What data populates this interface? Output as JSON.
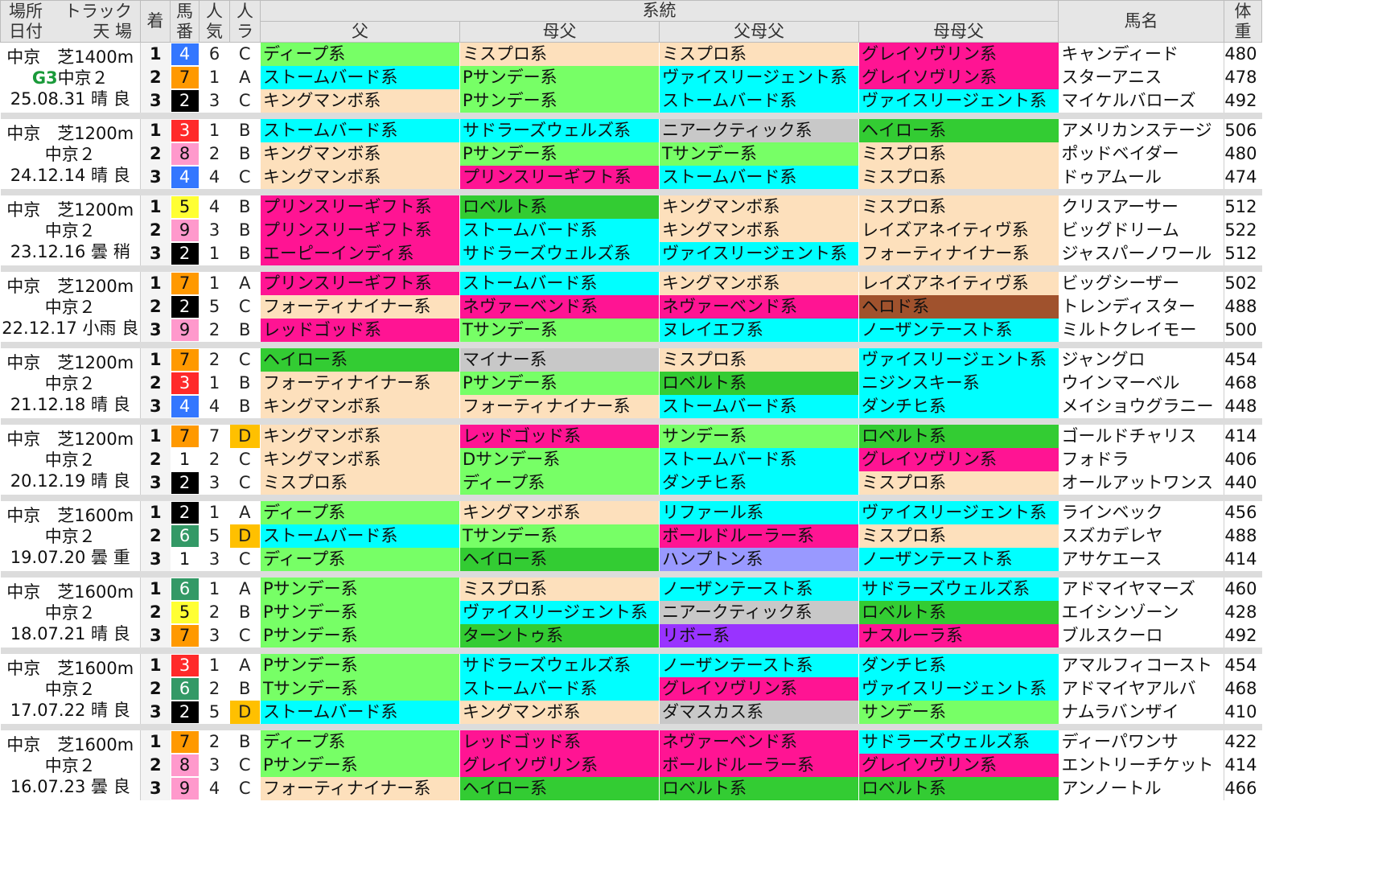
{
  "header": {
    "basho": "場所",
    "track": "トラック",
    "hizuke": "日付",
    "tenba": "天 場",
    "chaku": "着",
    "umaban": "馬番",
    "ninki": "人気",
    "ra": "人ラ",
    "keito": "系統",
    "chichi": "父",
    "hahachichi": "母父",
    "chichihahachichi": "父母父",
    "hahahahachichi": "母母父",
    "bamei": "馬名",
    "taiju": "体重"
  },
  "colors": {
    "ディープ系": "#77ff66",
    "ミスプロ系": "#fde0bc",
    "グレイソヴリン系": "#ff1493",
    "ストームバード系": "#00ffff",
    "Pサンデー系": "#77ff66",
    "ヴァイスリージェント系": "#00ffff",
    "キングマンボ系": "#fde0bc",
    "サドラーズウェルズ系": "#00ffff",
    "ニアークティック系": "#c8c8c8",
    "ヘイロー系": "#33cc33",
    "Tサンデー系": "#77ff66",
    "プリンスリーギフト系": "#ff1493",
    "ロベルト系": "#33cc33",
    "レイズアネイティヴ系": "#fde0bc",
    "エーピーインディ系": "#ff1493",
    "フォーティナイナー系": "#fde0bc",
    "ネヴァーベンド系": "#ff1493",
    "ヘロド系": "#a0522d",
    "レッドゴッド系": "#ff1493",
    "ヌレイエフ系": "#00ffff",
    "ノーザンテースト系": "#00ffff",
    "マイナー系": "#c8c8c8",
    "ニジンスキー系": "#00ffff",
    "ダンチヒ系": "#00ffff",
    "Dサンデー系": "#77ff66",
    "サンデー系": "#77ff66",
    "リファール系": "#00ffff",
    "ボールドルーラー系": "#ff1493",
    "ハンプトン系": "#9999ff",
    "ターントゥ系": "#33cc33",
    "リボー系": "#9933ff",
    "ナスルーラ系": "#ff1493",
    "ダマスカス系": "#c8c8c8"
  },
  "umaban_colors": {
    "1": {
      "bg": "#ffffff",
      "fg": "#111111"
    },
    "2": {
      "bg": "#000000",
      "fg": "#ffffff"
    },
    "3": {
      "bg": "#ff2a2a",
      "fg": "#ffffff"
    },
    "4": {
      "bg": "#3377ff",
      "fg": "#ffffff"
    },
    "5": {
      "bg": "#ffff33",
      "fg": "#111111"
    },
    "6": {
      "bg": "#339966",
      "fg": "#ffffff"
    },
    "7": {
      "bg": "#ff9900",
      "fg": "#111111"
    },
    "8": {
      "bg": "#ff99cc",
      "fg": "#111111"
    },
    "9": {
      "bg": "#ff99cc",
      "fg": "#111111"
    }
  },
  "races": [
    {
      "basho": "中京",
      "track": "芝1400m",
      "grade": "G3",
      "course": "中京２",
      "date": "25.08.31",
      "weather": "晴",
      "going": "良",
      "rows": [
        {
          "chaku": "1",
          "umaban": "4",
          "ninki": "6",
          "ra": "C",
          "chichi": "ディープ系",
          "hahachichi": "ミスプロ系",
          "chichihahachichi": "ミスプロ系",
          "hahahahachichi": "グレイソヴリン系",
          "bamei": "キャンディード",
          "taiju": "480"
        },
        {
          "chaku": "2",
          "umaban": "7",
          "ninki": "1",
          "ra": "A",
          "chichi": "ストームバード系",
          "hahachichi": "Pサンデー系",
          "chichihahachichi": "ヴァイスリージェント系",
          "hahahahachichi": "グレイソヴリン系",
          "bamei": "スターアニス",
          "taiju": "478"
        },
        {
          "chaku": "3",
          "umaban": "2",
          "ninki": "3",
          "ra": "C",
          "chichi": "キングマンボ系",
          "hahachichi": "Pサンデー系",
          "chichihahachichi": "ストームバード系",
          "hahahahachichi": "ヴァイスリージェント系",
          "bamei": "マイケルバローズ",
          "taiju": "492"
        }
      ]
    },
    {
      "basho": "中京",
      "track": "芝1200m",
      "grade": "",
      "course": "中京２",
      "date": "24.12.14",
      "weather": "晴",
      "going": "良",
      "rows": [
        {
          "chaku": "1",
          "umaban": "3",
          "ninki": "1",
          "ra": "B",
          "chichi": "ストームバード系",
          "hahachichi": "サドラーズウェルズ系",
          "chichihahachichi": "ニアークティック系",
          "hahahahachichi": "ヘイロー系",
          "bamei": "アメリカンステージ",
          "taiju": "506"
        },
        {
          "chaku": "2",
          "umaban": "8",
          "ninki": "2",
          "ra": "B",
          "chichi": "キングマンボ系",
          "hahachichi": "Pサンデー系",
          "chichihahachichi": "Tサンデー系",
          "hahahahachichi": "ミスプロ系",
          "bamei": "ポッドベイダー",
          "taiju": "480"
        },
        {
          "chaku": "3",
          "umaban": "4",
          "ninki": "4",
          "ra": "C",
          "chichi": "キングマンボ系",
          "hahachichi": "プリンスリーギフト系",
          "chichihahachichi": "ストームバード系",
          "hahahahachichi": "ミスプロ系",
          "bamei": "ドゥアムール",
          "taiju": "474"
        }
      ]
    },
    {
      "basho": "中京",
      "track": "芝1200m",
      "grade": "",
      "course": "中京２",
      "date": "23.12.16",
      "weather": "曇",
      "going": "稍",
      "rows": [
        {
          "chaku": "1",
          "umaban": "5",
          "ninki": "4",
          "ra": "B",
          "chichi": "プリンスリーギフト系",
          "hahachichi": "ロベルト系",
          "chichihahachichi": "キングマンボ系",
          "hahahahachichi": "ミスプロ系",
          "bamei": "クリスアーサー",
          "taiju": "512"
        },
        {
          "chaku": "2",
          "umaban": "9",
          "ninki": "3",
          "ra": "B",
          "chichi": "プリンスリーギフト系",
          "hahachichi": "ストームバード系",
          "chichihahachichi": "キングマンボ系",
          "hahahahachichi": "レイズアネイティヴ系",
          "bamei": "ビッグドリーム",
          "taiju": "522"
        },
        {
          "chaku": "3",
          "umaban": "2",
          "ninki": "1",
          "ra": "B",
          "chichi": "エーピーインディ系",
          "hahachichi": "サドラーズウェルズ系",
          "chichihahachichi": "ヴァイスリージェント系",
          "hahahahachichi": "フォーティナイナー系",
          "bamei": "ジャスパーノワール",
          "taiju": "512"
        }
      ]
    },
    {
      "basho": "中京",
      "track": "芝1200m",
      "grade": "",
      "course": "中京２",
      "date": "22.12.17",
      "weather": "小雨",
      "going": "良",
      "rows": [
        {
          "chaku": "1",
          "umaban": "7",
          "ninki": "1",
          "ra": "A",
          "chichi": "プリンスリーギフト系",
          "hahachichi": "ストームバード系",
          "chichihahachichi": "キングマンボ系",
          "hahahahachichi": "レイズアネイティヴ系",
          "bamei": "ビッグシーザー",
          "taiju": "502"
        },
        {
          "chaku": "2",
          "umaban": "2",
          "ninki": "5",
          "ra": "C",
          "chichi": "フォーティナイナー系",
          "hahachichi": "ネヴァーベンド系",
          "chichihahachichi": "ネヴァーベンド系",
          "hahahahachichi": "ヘロド系",
          "bamei": "トレンディスター",
          "taiju": "488"
        },
        {
          "chaku": "3",
          "umaban": "9",
          "ninki": "2",
          "ra": "B",
          "chichi": "レッドゴッド系",
          "hahachichi": "Tサンデー系",
          "chichihahachichi": "ヌレイエフ系",
          "hahahahachichi": "ノーザンテースト系",
          "bamei": "ミルトクレイモー",
          "taiju": "500"
        }
      ]
    },
    {
      "basho": "中京",
      "track": "芝1200m",
      "grade": "",
      "course": "中京２",
      "date": "21.12.18",
      "weather": "晴",
      "going": "良",
      "rows": [
        {
          "chaku": "1",
          "umaban": "7",
          "ninki": "2",
          "ra": "C",
          "chichi": "ヘイロー系",
          "hahachichi": "マイナー系",
          "chichihahachichi": "ミスプロ系",
          "hahahahachichi": "ヴァイスリージェント系",
          "bamei": "ジャングロ",
          "taiju": "454"
        },
        {
          "chaku": "2",
          "umaban": "3",
          "ninki": "1",
          "ra": "B",
          "chichi": "フォーティナイナー系",
          "hahachichi": "Pサンデー系",
          "chichihahachichi": "ロベルト系",
          "hahahahachichi": "ニジンスキー系",
          "bamei": "ウインマーベル",
          "taiju": "468"
        },
        {
          "chaku": "3",
          "umaban": "4",
          "ninki": "4",
          "ra": "B",
          "chichi": "キングマンボ系",
          "hahachichi": "フォーティナイナー系",
          "chichihahachichi": "ストームバード系",
          "hahahahachichi": "ダンチヒ系",
          "bamei": "メイショウグラニー",
          "taiju": "448"
        }
      ]
    },
    {
      "basho": "中京",
      "track": "芝1200m",
      "grade": "",
      "course": "中京２",
      "date": "20.12.19",
      "weather": "晴",
      "going": "良",
      "rows": [
        {
          "chaku": "1",
          "umaban": "7",
          "ninki": "7",
          "ra": "D",
          "chichi": "キングマンボ系",
          "hahachichi": "レッドゴッド系",
          "chichihahachichi": "サンデー系",
          "hahahahachichi": "ロベルト系",
          "bamei": "ゴールドチャリス",
          "taiju": "414"
        },
        {
          "chaku": "2",
          "umaban": "1",
          "ninki": "2",
          "ra": "C",
          "chichi": "キングマンボ系",
          "hahachichi": "Dサンデー系",
          "chichihahachichi": "ストームバード系",
          "hahahahachichi": "グレイソヴリン系",
          "bamei": "フォドラ",
          "taiju": "406"
        },
        {
          "chaku": "3",
          "umaban": "2",
          "ninki": "3",
          "ra": "C",
          "chichi": "ミスプロ系",
          "hahachichi": "ディープ系",
          "chichihahachichi": "ダンチヒ系",
          "hahahahachichi": "ミスプロ系",
          "bamei": "オールアットワンス",
          "taiju": "440"
        }
      ]
    },
    {
      "basho": "中京",
      "track": "芝1600m",
      "grade": "",
      "course": "中京２",
      "date": "19.07.20",
      "weather": "曇",
      "going": "重",
      "rows": [
        {
          "chaku": "1",
          "umaban": "2",
          "ninki": "1",
          "ra": "A",
          "chichi": "ディープ系",
          "hahachichi": "キングマンボ系",
          "chichihahachichi": "リファール系",
          "hahahahachichi": "ヴァイスリージェント系",
          "bamei": "ラインベック",
          "taiju": "456"
        },
        {
          "chaku": "2",
          "umaban": "6",
          "ninki": "5",
          "ra": "D",
          "chichi": "ストームバード系",
          "hahachichi": "Tサンデー系",
          "chichihahachichi": "ボールドルーラー系",
          "hahahahachichi": "ミスプロ系",
          "bamei": "スズカデレヤ",
          "taiju": "488"
        },
        {
          "chaku": "3",
          "umaban": "1",
          "ninki": "3",
          "ra": "C",
          "chichi": "ディープ系",
          "hahachichi": "ヘイロー系",
          "chichihahachichi": "ハンプトン系",
          "hahahahachichi": "ノーザンテースト系",
          "bamei": "アサケエース",
          "taiju": "414"
        }
      ]
    },
    {
      "basho": "中京",
      "track": "芝1600m",
      "grade": "",
      "course": "中京２",
      "date": "18.07.21",
      "weather": "晴",
      "going": "良",
      "rows": [
        {
          "chaku": "1",
          "umaban": "6",
          "ninki": "1",
          "ra": "A",
          "chichi": "Pサンデー系",
          "hahachichi": "ミスプロ系",
          "chichihahachichi": "ノーザンテースト系",
          "hahahahachichi": "サドラーズウェルズ系",
          "bamei": "アドマイヤマーズ",
          "taiju": "460"
        },
        {
          "chaku": "2",
          "umaban": "5",
          "ninki": "2",
          "ra": "B",
          "chichi": "Pサンデー系",
          "hahachichi": "ヴァイスリージェント系",
          "chichihahachichi": "ニアークティック系",
          "hahahahachichi": "ロベルト系",
          "bamei": "エイシンゾーン",
          "taiju": "428"
        },
        {
          "chaku": "3",
          "umaban": "7",
          "ninki": "3",
          "ra": "C",
          "chichi": "Pサンデー系",
          "hahachichi": "ターントゥ系",
          "chichihahachichi": "リボー系",
          "hahahahachichi": "ナスルーラ系",
          "bamei": "ブルスクーロ",
          "taiju": "492"
        }
      ]
    },
    {
      "basho": "中京",
      "track": "芝1600m",
      "grade": "",
      "course": "中京２",
      "date": "17.07.22",
      "weather": "晴",
      "going": "良",
      "rows": [
        {
          "chaku": "1",
          "umaban": "3",
          "ninki": "1",
          "ra": "A",
          "chichi": "Pサンデー系",
          "hahachichi": "サドラーズウェルズ系",
          "chichihahachichi": "ノーザンテースト系",
          "hahahahachichi": "ダンチヒ系",
          "bamei": "アマルフィコースト",
          "taiju": "454"
        },
        {
          "chaku": "2",
          "umaban": "6",
          "ninki": "2",
          "ra": "B",
          "chichi": "Tサンデー系",
          "hahachichi": "ストームバード系",
          "chichihahachichi": "グレイソヴリン系",
          "hahahahachichi": "ヴァイスリージェント系",
          "bamei": "アドマイヤアルバ",
          "taiju": "468"
        },
        {
          "chaku": "3",
          "umaban": "2",
          "ninki": "5",
          "ra": "D",
          "chichi": "ストームバード系",
          "hahachichi": "キングマンボ系",
          "chichihahachichi": "ダマスカス系",
          "hahahahachichi": "サンデー系",
          "bamei": "ナムラバンザイ",
          "taiju": "410"
        }
      ]
    },
    {
      "basho": "中京",
      "track": "芝1600m",
      "grade": "",
      "course": "中京２",
      "date": "16.07.23",
      "weather": "曇",
      "going": "良",
      "rows": [
        {
          "chaku": "1",
          "umaban": "7",
          "ninki": "2",
          "ra": "B",
          "chichi": "ディープ系",
          "hahachichi": "レッドゴッド系",
          "chichihahachichi": "ネヴァーベンド系",
          "hahahahachichi": "サドラーズウェルズ系",
          "bamei": "ディーパワンサ",
          "taiju": "422"
        },
        {
          "chaku": "2",
          "umaban": "8",
          "ninki": "3",
          "ra": "C",
          "chichi": "Pサンデー系",
          "hahachichi": "グレイソヴリン系",
          "chichihahachichi": "ボールドルーラー系",
          "hahahahachichi": "グレイソヴリン系",
          "bamei": "エントリーチケット",
          "taiju": "414"
        },
        {
          "chaku": "3",
          "umaban": "9",
          "ninki": "4",
          "ra": "C",
          "chichi": "フォーティナイナー系",
          "hahachichi": "ヘイロー系",
          "chichihahachichi": "ロベルト系",
          "hahahahachichi": "ロベルト系",
          "bamei": "アンノートル",
          "taiju": "466"
        }
      ]
    }
  ]
}
